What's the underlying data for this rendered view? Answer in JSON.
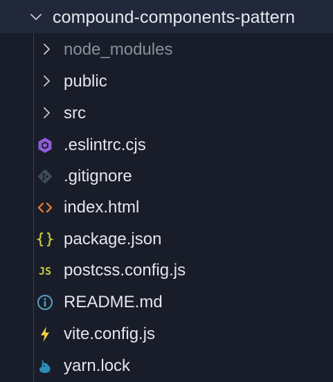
{
  "explorer": {
    "root": {
      "label": "compound-components-pattern",
      "expanded": true,
      "icon": "chevron-down-icon"
    },
    "folders": [
      {
        "label": "node_modules",
        "dimmed": true,
        "icon": "chevron-right-icon"
      },
      {
        "label": "public",
        "dimmed": false,
        "icon": "chevron-right-icon"
      },
      {
        "label": "src",
        "dimmed": false,
        "icon": "chevron-right-icon"
      }
    ],
    "files": [
      {
        "label": ".eslintrc.cjs",
        "icon": "eslint-icon",
        "icon_color": "#8f5bd6"
      },
      {
        "label": ".gitignore",
        "icon": "git-icon",
        "icon_color": "#3d4b5a"
      },
      {
        "label": "index.html",
        "icon": "html-icon",
        "icon_color": "#e37933",
        "icon_glyph": "<>"
      },
      {
        "label": "package.json",
        "icon": "json-icon",
        "icon_color": "#cbcb41",
        "icon_glyph": "{}"
      },
      {
        "label": "postcss.config.js",
        "icon": "javascript-icon",
        "icon_color": "#cbcb41",
        "icon_glyph": "JS"
      },
      {
        "label": "README.md",
        "icon": "info-icon",
        "icon_color": "#519aba"
      },
      {
        "label": "vite.config.js",
        "icon": "vite-icon",
        "icon_color": "#f3d43f"
      },
      {
        "label": "yarn.lock",
        "icon": "yarn-icon",
        "icon_color": "#2c8ebb"
      }
    ]
  }
}
